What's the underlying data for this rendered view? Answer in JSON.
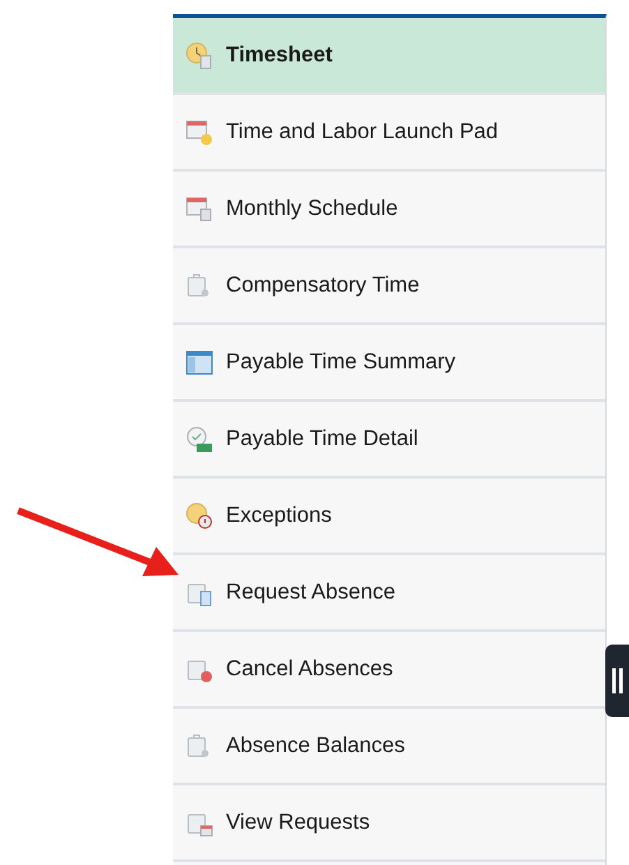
{
  "menu": {
    "items": [
      {
        "label": "Timesheet",
        "selected": true,
        "kind": "timesheet"
      },
      {
        "label": "Time and Labor Launch Pad",
        "selected": false,
        "kind": "launchpad"
      },
      {
        "label": "Monthly Schedule",
        "selected": false,
        "kind": "schedule"
      },
      {
        "label": "Compensatory Time",
        "selected": false,
        "kind": "case"
      },
      {
        "label": "Payable Time Summary",
        "selected": false,
        "kind": "summary"
      },
      {
        "label": "Payable Time Detail",
        "selected": false,
        "kind": "detail"
      },
      {
        "label": "Exceptions",
        "selected": false,
        "kind": "exceptions"
      },
      {
        "label": "Request Absence",
        "selected": false,
        "kind": "request"
      },
      {
        "label": "Cancel Absences",
        "selected": false,
        "kind": "cancel"
      },
      {
        "label": "Absence Balances",
        "selected": false,
        "kind": "case"
      },
      {
        "label": "View Requests",
        "selected": false,
        "kind": "view"
      }
    ]
  },
  "annotation": {
    "kind": "arrow"
  }
}
